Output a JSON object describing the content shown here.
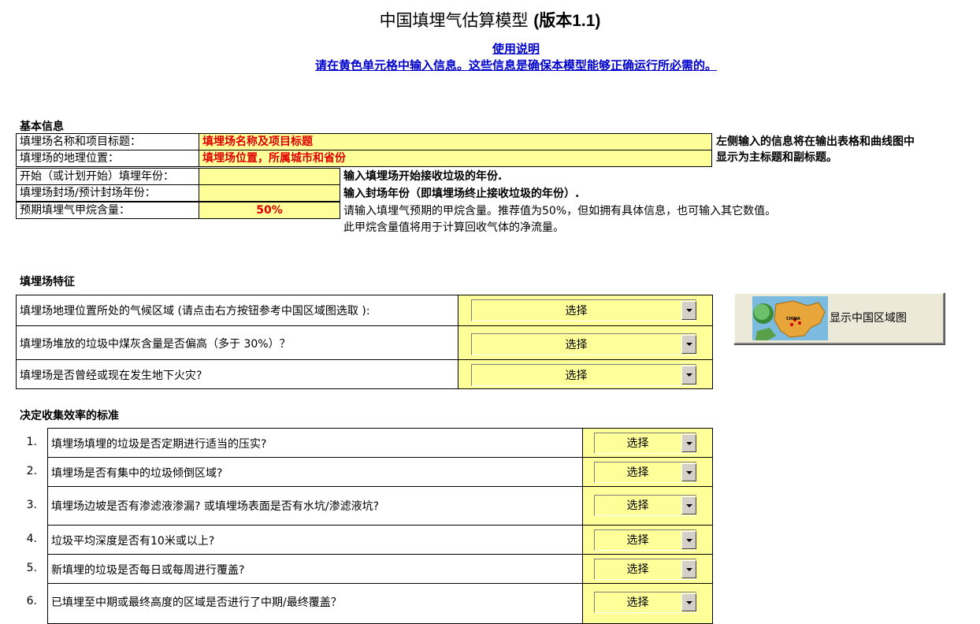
{
  "header": {
    "title_cn": "中国填埋气估算模型",
    "title_version": "(版本1.1)",
    "instructions_link": "使用说明",
    "instructions_text": "请在黄色单元格中输入信息。这些信息是确保本模型能够正确运行所必需的。"
  },
  "basic": {
    "section_title": "基本信息",
    "rows": [
      {
        "label": "填埋场名称和项目标题：",
        "value": "填埋场名称及项目标题"
      },
      {
        "label": "填埋场的地理位置：",
        "value": "填埋场位置，所属城市和省份"
      },
      {
        "label": "开始（或计划开始）填埋年份：",
        "value": ""
      },
      {
        "label": "填埋场封场/预计封场年份：",
        "value": ""
      },
      {
        "label": "预期填埋气甲烷含量：",
        "value": "50%"
      }
    ],
    "note_title_line1": "左侧输入的信息将在输出表格和曲线图中",
    "note_title_line2": "显示为主标题和副标题。",
    "note_start_year": "输入填埋场开始接收垃圾的年份.",
    "note_close_year": "输入封场年份（即填埋场终止接收垃圾的年份）.",
    "note_methane_line1": "请输入填埋气预期的甲烷含量。推荐值为50%，但如拥有具体信息，也可输入其它数值。",
    "note_methane_line2": "此甲烷含量值将用于计算回收气体的净流量。"
  },
  "characteristics": {
    "section_title": "填埋场特征",
    "rows": [
      {
        "question": "填埋场地理位置所处的气候区域 (请点击右方按钮参考中国区域图选取 ):",
        "select": "选择"
      },
      {
        "question": "填埋场堆放的垃圾中煤灰含量是否偏高（多于 30%）？",
        "select": "选择"
      },
      {
        "question": "填埋场是否曾经或现在发生地下火灾?",
        "select": "选择"
      }
    ],
    "map_button_label": "显示中国区域图",
    "map_country_label": "CHINA"
  },
  "efficiency": {
    "section_title": "决定收集效率的标准",
    "rows": [
      {
        "num": "1.",
        "question": "填埋场填埋的垃圾是否定期进行适当的压实?",
        "select": "选择"
      },
      {
        "num": "2.",
        "question": "填埋场是否有集中的垃圾倾倒区域?",
        "select": "选择"
      },
      {
        "num": "3.",
        "question": "填埋场边坡是否有渗滤液渗漏? 或填埋场表面是否有水坑/渗滤液坑?",
        "select": "选择"
      },
      {
        "num": "4.",
        "question": "垃圾平均深度是否有10米或以上?",
        "select": "选择"
      },
      {
        "num": "5.",
        "question": "新填埋的垃圾是否每日或每周进行覆盖?",
        "select": "选择"
      },
      {
        "num": "6.",
        "question": "已填埋至中期或最终高度的区域是否进行了中期/最终覆盖？",
        "select": "选择"
      }
    ]
  },
  "colors": {
    "input_yellow": "#ffff99",
    "link_blue": "#0000cc",
    "alert_red": "#e00000"
  }
}
